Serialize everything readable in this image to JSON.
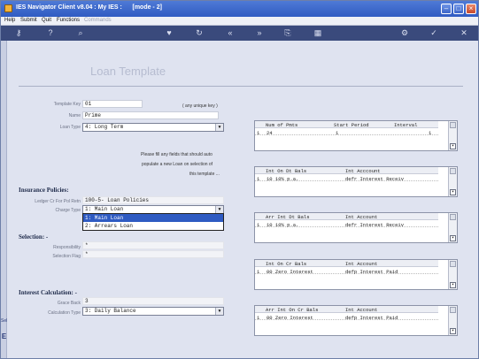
{
  "window": {
    "title": "IES Navigator Client v8.04 : My IES :      [mode - 2]"
  },
  "menu": {
    "items": [
      "Help",
      "Submit",
      "Quit",
      "Functions"
    ],
    "disabled_item": "Commands"
  },
  "toolbar": {
    "icons": [
      "key-icon",
      "info-icon",
      "search-icon",
      "heart-icon",
      "refresh-icon",
      "rewind-icon",
      "forward-icon",
      "copy-icon",
      "grid-icon",
      "tools-icon",
      "check-icon",
      "close-icon"
    ]
  },
  "page": {
    "heading": "Loan Template"
  },
  "form": {
    "template_key": {
      "label": "Template Key",
      "value": "01",
      "hint": "( any unique key )"
    },
    "name": {
      "label": "Name",
      "value": "Prime"
    },
    "loan_type": {
      "label": "Loan Type",
      "value": "4: Long Term"
    },
    "note_line1": "Please fill any fields that should auto",
    "note_line2": "populate a new Loan on selection of",
    "note_line3": "this template ..."
  },
  "insurance": {
    "section_title": "Insurance Policies:",
    "ledger": {
      "label": "Ledger Cr For Pol Retn",
      "value": "100-5- Loan Policies"
    },
    "charge_type": {
      "label": "Charge Type",
      "value": "1: Main Loan",
      "options": [
        "1: Main Loan",
        "2: Arrears Loan"
      ]
    }
  },
  "selection": {
    "section_title": "Selection: -",
    "responsibility": {
      "label": "Responsibility",
      "value": "*"
    },
    "selection_flag": {
      "label": "Selection Flag",
      "value": "*"
    }
  },
  "interest": {
    "section_title": "Interest Calculation: -",
    "grace_back": {
      "label": "Grace Back",
      "value": "3"
    },
    "calculation_type": {
      "label": "Calculation Type",
      "value": "3: Daily Balance"
    }
  },
  "grids": [
    {
      "headers": [
        "Num of Pmts",
        "Start Period",
        "Interval"
      ],
      "row": [
        "1",
        "24",
        "1",
        "1"
      ]
    },
    {
      "headers": [
        "Int On Dt Bals",
        "Int Acccount"
      ],
      "row": [
        "1",
        "10 10% p.a.",
        "defr Interest Receiv"
      ]
    },
    {
      "headers": [
        "Arr Int Dt Bals",
        "Int Account"
      ],
      "row": [
        "1",
        "10 10% p.a.",
        "defr Interest Receiv"
      ]
    },
    {
      "headers": [
        "Int On Cr Bals",
        "Int Account"
      ],
      "row": [
        "1",
        "00 Zero Interest",
        "defp Interest Paid"
      ]
    },
    {
      "headers": [
        "Arr Int On Cr Bals",
        "Int Account"
      ],
      "row": [
        "1",
        "00 Zero Interest",
        "defp Interest Paid"
      ]
    }
  ],
  "leftbar": {
    "tags": [
      "Sel",
      "E"
    ]
  }
}
